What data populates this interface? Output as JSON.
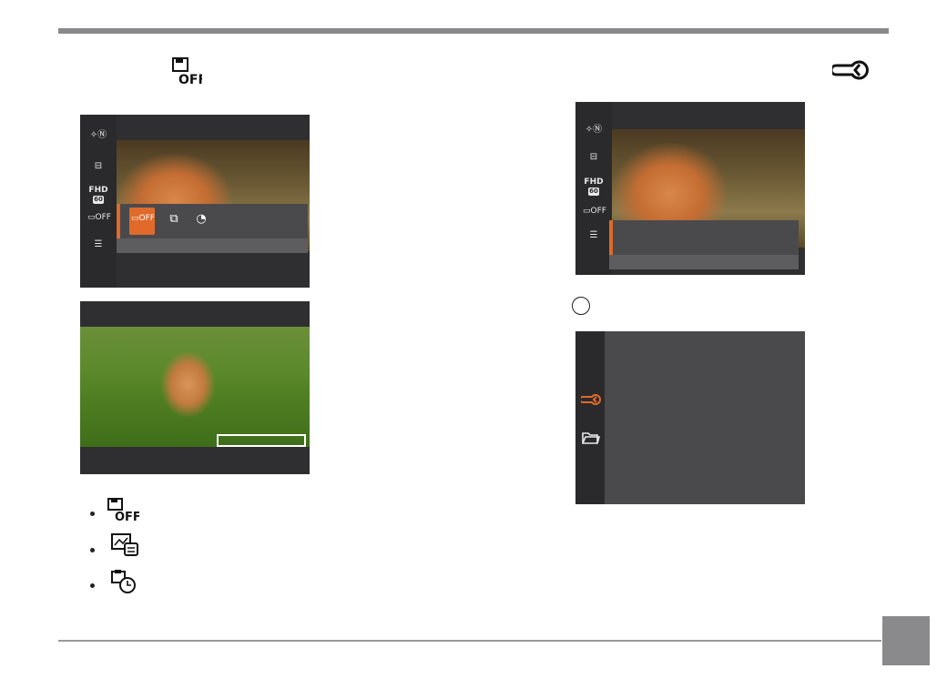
{
  "icons": {
    "scene_mode": "scene-n-icon",
    "exposure": "exposure-icon",
    "video_quality": "fhd-icon",
    "date_stamp": "date-stamp-off-icon",
    "menu": "menu-icon",
    "wrench": "wrench-icon",
    "folder": "folder-icon"
  },
  "camera_menu": {
    "fhd_label": "FHD",
    "fhd_sub": "60",
    "date_off_label": "OFF"
  },
  "colors": {
    "accent": "#e06a2a",
    "header_bar": "#8a8a8c",
    "screen_bg": "#2f2f31",
    "panel_bg": "#4a4a4d"
  }
}
